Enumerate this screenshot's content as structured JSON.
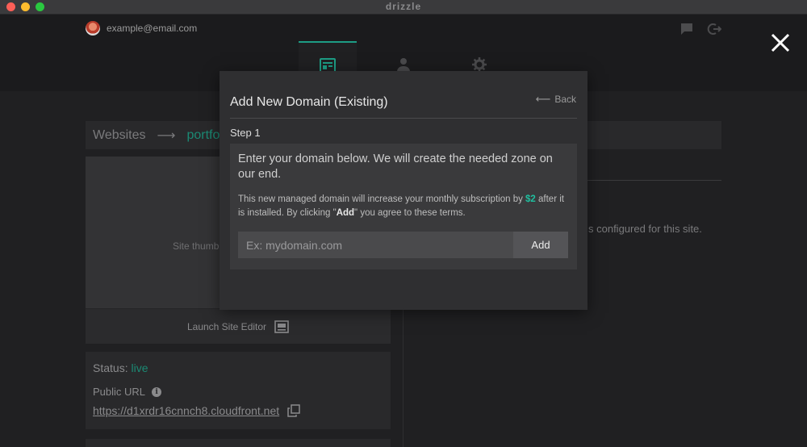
{
  "window": {
    "app_name": "drizzle"
  },
  "header": {
    "user_email": "example@email.com",
    "nav_tabs": [
      {
        "icon": "sites-icon",
        "active": true
      },
      {
        "icon": "account-icon",
        "active": false
      },
      {
        "icon": "settings-icon",
        "active": false
      }
    ]
  },
  "breadcrumb": {
    "root": "Websites",
    "separator": "⟶",
    "current": "portfolio"
  },
  "site_card": {
    "thumbnail_label": "Site thumb",
    "launch_label": "Launch Site Editor"
  },
  "status": {
    "label": "Status:",
    "value": "live",
    "public_url_label": "Public URL",
    "public_url": "https://d1xrdr16cnnch8.cloudfront.net"
  },
  "right_panel": {
    "text": "s configured for this site."
  },
  "modal": {
    "title": "Add New Domain (Existing)",
    "back_label": "Back",
    "step_label": "Step 1",
    "lead_text": "Enter your domain below. We will create the needed zone on our end.",
    "note_part1": "This new managed domain will increase your monthly subscription by ",
    "price": "$2",
    "note_part2": " after it is installed. By clicking \"",
    "add_term": "Add",
    "note_part3": "\" you agree to these terms.",
    "input_placeholder": "Ex: mydomain.com",
    "input_value": "",
    "add_button_label": "Add"
  },
  "colors": {
    "accent": "#1d9d85",
    "price": "#1fbf9f",
    "modal_bg": "#2f2f31"
  }
}
